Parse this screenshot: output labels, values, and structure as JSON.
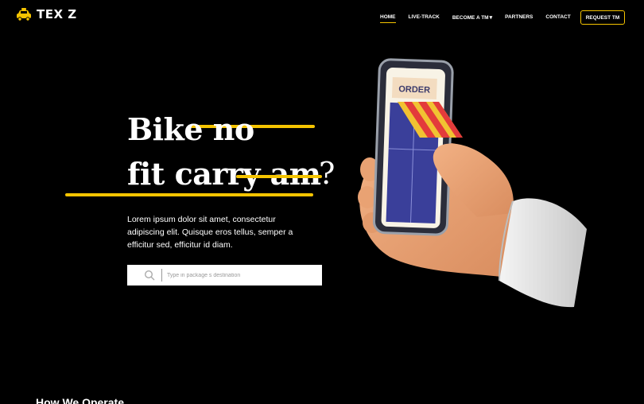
{
  "brand": {
    "name": "TEX Z",
    "logo_icon": "taxi-car-icon",
    "accent": "#f5c400"
  },
  "nav": {
    "items": [
      {
        "label": "HOME",
        "active": true
      },
      {
        "label": "LIVE-TRACK",
        "active": false
      },
      {
        "label": "BECOME A TM",
        "active": false,
        "has_dropdown": true
      },
      {
        "label": "PARTNERS",
        "active": false
      },
      {
        "label": "CONTACT",
        "active": false
      }
    ],
    "cta_label": "REQUEST TM"
  },
  "hero": {
    "line1": "Bike no",
    "line2": "fit carry am",
    "question_mark": "?",
    "description": "Lorem ipsum dolor sit amet, consectetur adipiscing elit. Quisque eros tellus, semper a efficitur sed, efficitur id diam.",
    "phone_screen_label": "ORDER"
  },
  "search": {
    "placeholder": "Type in package s destination",
    "value": "",
    "icon": "search-icon"
  },
  "next_section": {
    "title": "How We Operate"
  }
}
